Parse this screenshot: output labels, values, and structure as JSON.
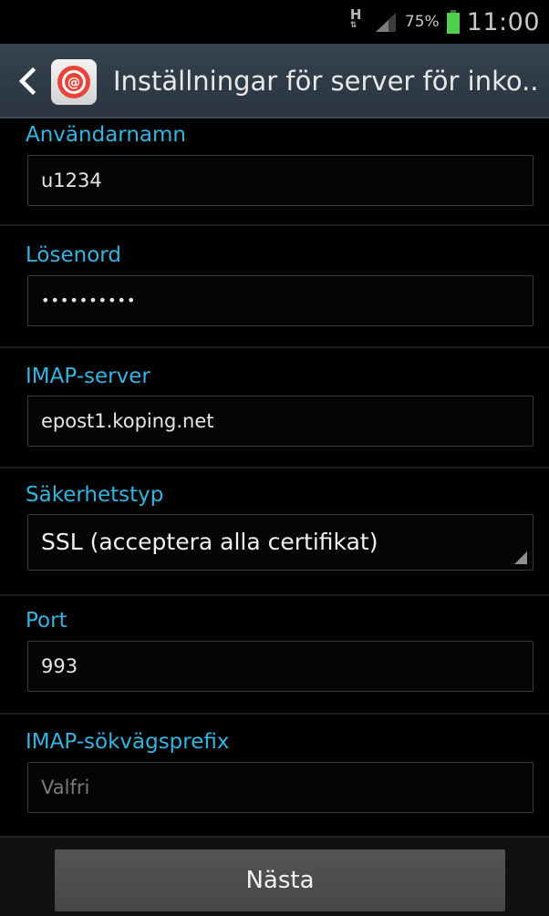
{
  "status_bar": {
    "network_type": "H",
    "battery_percent": "75%",
    "time": "11:00",
    "icons": [
      "network-type-icon",
      "signal-icon",
      "battery-icon"
    ]
  },
  "action_bar": {
    "title": "Inställningar för server för inko..",
    "back_icon": "chevron-left-icon",
    "app_icon": "email-app-icon"
  },
  "fields": {
    "username": {
      "label": "Användarnamn",
      "value": "u1234"
    },
    "password": {
      "label": "Lösenord",
      "value": "••••••••••"
    },
    "imap_server": {
      "label": "IMAP-server",
      "value": "epost1.koping.net"
    },
    "security_type": {
      "label": "Säkerhetstyp",
      "value": "SSL (acceptera alla certifikat)"
    },
    "port": {
      "label": "Port",
      "value": "993"
    },
    "imap_path_prefix": {
      "label": "IMAP-sökvägsprefix",
      "placeholder": "Valfri",
      "value": ""
    }
  },
  "footer": {
    "next_label": "Nästa"
  },
  "colors": {
    "accent_label": "#35b4e0",
    "action_bar": "#2f3c48",
    "battery": "#4fd04f"
  }
}
